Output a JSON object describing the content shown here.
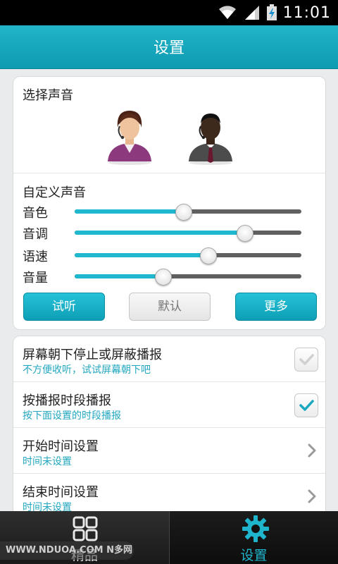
{
  "status_bar": {
    "time": "11:01",
    "icons": [
      "wifi-icon",
      "signal-icon",
      "battery-charging-icon"
    ]
  },
  "header": {
    "title": "设置"
  },
  "voice": {
    "title": "选择声音",
    "avatars": [
      "female-voice-avatar",
      "male-voice-avatar"
    ]
  },
  "custom": {
    "title": "自定义声音",
    "sliders": [
      {
        "label": "音色",
        "value": 0.48
      },
      {
        "label": "音调",
        "value": 0.75
      },
      {
        "label": "语速",
        "value": 0.59
      },
      {
        "label": "音量",
        "value": 0.39
      }
    ],
    "buttons": {
      "try": "试听",
      "default": "默认",
      "more": "更多"
    }
  },
  "settings": [
    {
      "title": "屏幕朝下停止或屏蔽播报",
      "subtitle": "不方便收听，试试屏幕朝下吧",
      "type": "checkbox",
      "checked": false
    },
    {
      "title": "按播报时段播报",
      "subtitle": "按下面设置的时段播报",
      "type": "checkbox",
      "checked": true
    },
    {
      "title": "开始时间设置",
      "subtitle": "时间未设置",
      "type": "link"
    },
    {
      "title": "结束时间设置",
      "subtitle": "时间未设置",
      "type": "link"
    }
  ],
  "nav": {
    "tab1": "精品",
    "tab2": "设置"
  },
  "watermark": "WWW.NDUOA.COM  N多网",
  "colors": {
    "accent": "#20b8cf",
    "header": "#16a9be",
    "checkmark": "#1aa8c0"
  }
}
